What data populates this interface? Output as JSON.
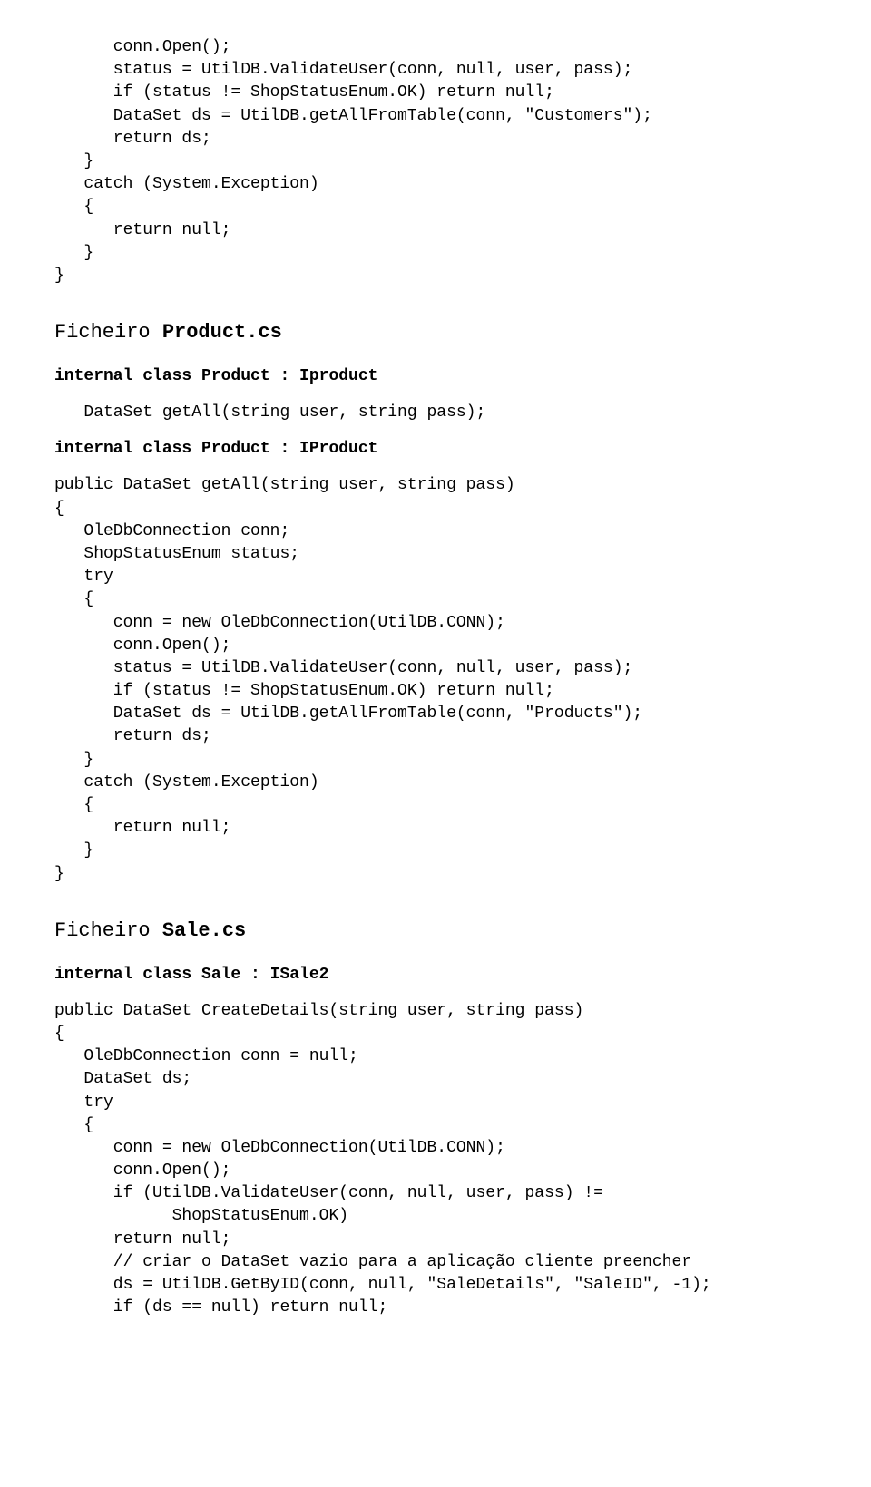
{
  "block1": "      conn.Open();\n      status = UtilDB.ValidateUser(conn, null, user, pass);\n      if (status != ShopStatusEnum.OK) return null;\n      DataSet ds = UtilDB.getAllFromTable(conn, \"Customers\");\n      return ds;\n   }\n   catch (System.Exception)\n   {\n      return null;\n   }\n}",
  "heading1_pre": "Ficheiro ",
  "heading1_bold": "Product.cs",
  "bold1": "internal class Product : Iproduct",
  "block2": "   DataSet getAll(string user, string pass);",
  "bold2": "internal class Product : IProduct",
  "block3": "public DataSet getAll(string user, string pass)\n{\n   OleDbConnection conn;\n   ShopStatusEnum status;\n   try\n   {\n      conn = new OleDbConnection(UtilDB.CONN);\n      conn.Open();\n      status = UtilDB.ValidateUser(conn, null, user, pass);\n      if (status != ShopStatusEnum.OK) return null;\n      DataSet ds = UtilDB.getAllFromTable(conn, \"Products\");\n      return ds;\n   }\n   catch (System.Exception)\n   {\n      return null;\n   }\n}",
  "heading2_pre": "Ficheiro ",
  "heading2_bold": "Sale.cs",
  "bold3": "internal class Sale : ISale2",
  "block4": "public DataSet CreateDetails(string user, string pass)\n{\n   OleDbConnection conn = null;\n   DataSet ds;\n   try\n   {\n      conn = new OleDbConnection(UtilDB.CONN);\n      conn.Open();\n      if (UtilDB.ValidateUser(conn, null, user, pass) !=\n            ShopStatusEnum.OK)\n      return null;\n      // criar o DataSet vazio para a aplicação cliente preencher\n      ds = UtilDB.GetByID(conn, null, \"SaleDetails\", \"SaleID\", -1);\n      if (ds == null) return null;"
}
